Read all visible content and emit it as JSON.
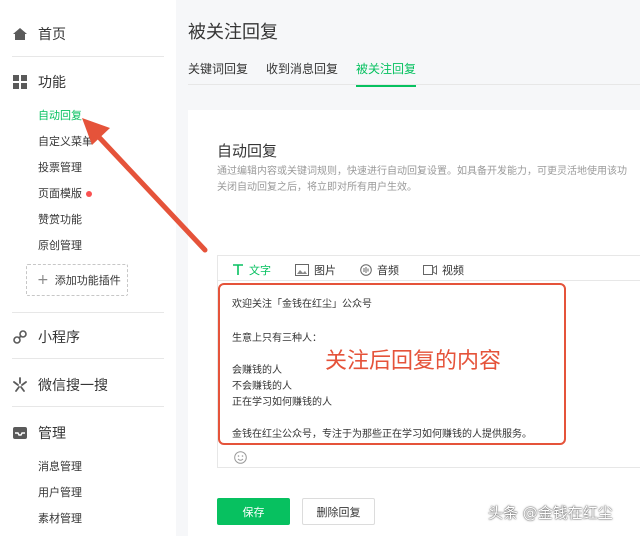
{
  "sidebar": {
    "sections": [
      {
        "label": "首页",
        "icon": "home-icon"
      },
      {
        "label": "功能",
        "icon": "grid-icon"
      },
      {
        "label": "小程序",
        "icon": "link-icon"
      },
      {
        "label": "微信搜一搜",
        "icon": "sparkle-icon"
      },
      {
        "label": "管理",
        "icon": "inbox-icon"
      }
    ],
    "function_items": [
      {
        "label": "自动回复",
        "active": true
      },
      {
        "label": "自定义菜单"
      },
      {
        "label": "投票管理"
      },
      {
        "label": "页面模版",
        "badge": "red-dot"
      },
      {
        "label": "赞赏功能"
      },
      {
        "label": "原创管理"
      }
    ],
    "add_plugin": "添加功能插件",
    "manage_items": [
      {
        "label": "消息管理"
      },
      {
        "label": "用户管理"
      },
      {
        "label": "素材管理"
      }
    ]
  },
  "header": {
    "title": "被关注回复"
  },
  "tabs": [
    {
      "label": "关键词回复"
    },
    {
      "label": "收到消息回复"
    },
    {
      "label": "被关注回复",
      "active": true
    }
  ],
  "panel": {
    "title": "自动回复",
    "desc_line1": "通过编辑内容或关键词规则，快速进行自动回复设置。如具备开发能力，可更灵活地使用该功",
    "desc_line2": "关闭自动回复之后，将立即对所有用户生效。"
  },
  "editor": {
    "tools": [
      {
        "label": "文字",
        "icon": "text-icon",
        "active": true
      },
      {
        "label": "图片",
        "icon": "image-icon"
      },
      {
        "label": "音频",
        "icon": "audio-icon"
      },
      {
        "label": "视频",
        "icon": "video-icon"
      }
    ],
    "content": [
      "欢迎关注「金钱在红尘」公众号",
      "生意上只有三种人：",
      "会赚钱的人",
      "不会赚钱的人",
      "正在学习如何赚钱的人",
      "金钱在红尘公众号，专注于为那些正在学习如何赚钱的人提供服务。"
    ]
  },
  "annotation": "关注后回复的内容",
  "actions": {
    "save": "保存",
    "delete": "删除回复"
  },
  "watermark": "头条 @金钱在红尘",
  "colors": {
    "accent": "#07c160",
    "annotation_red": "#e5533a",
    "badge_red": "#fa5151"
  }
}
